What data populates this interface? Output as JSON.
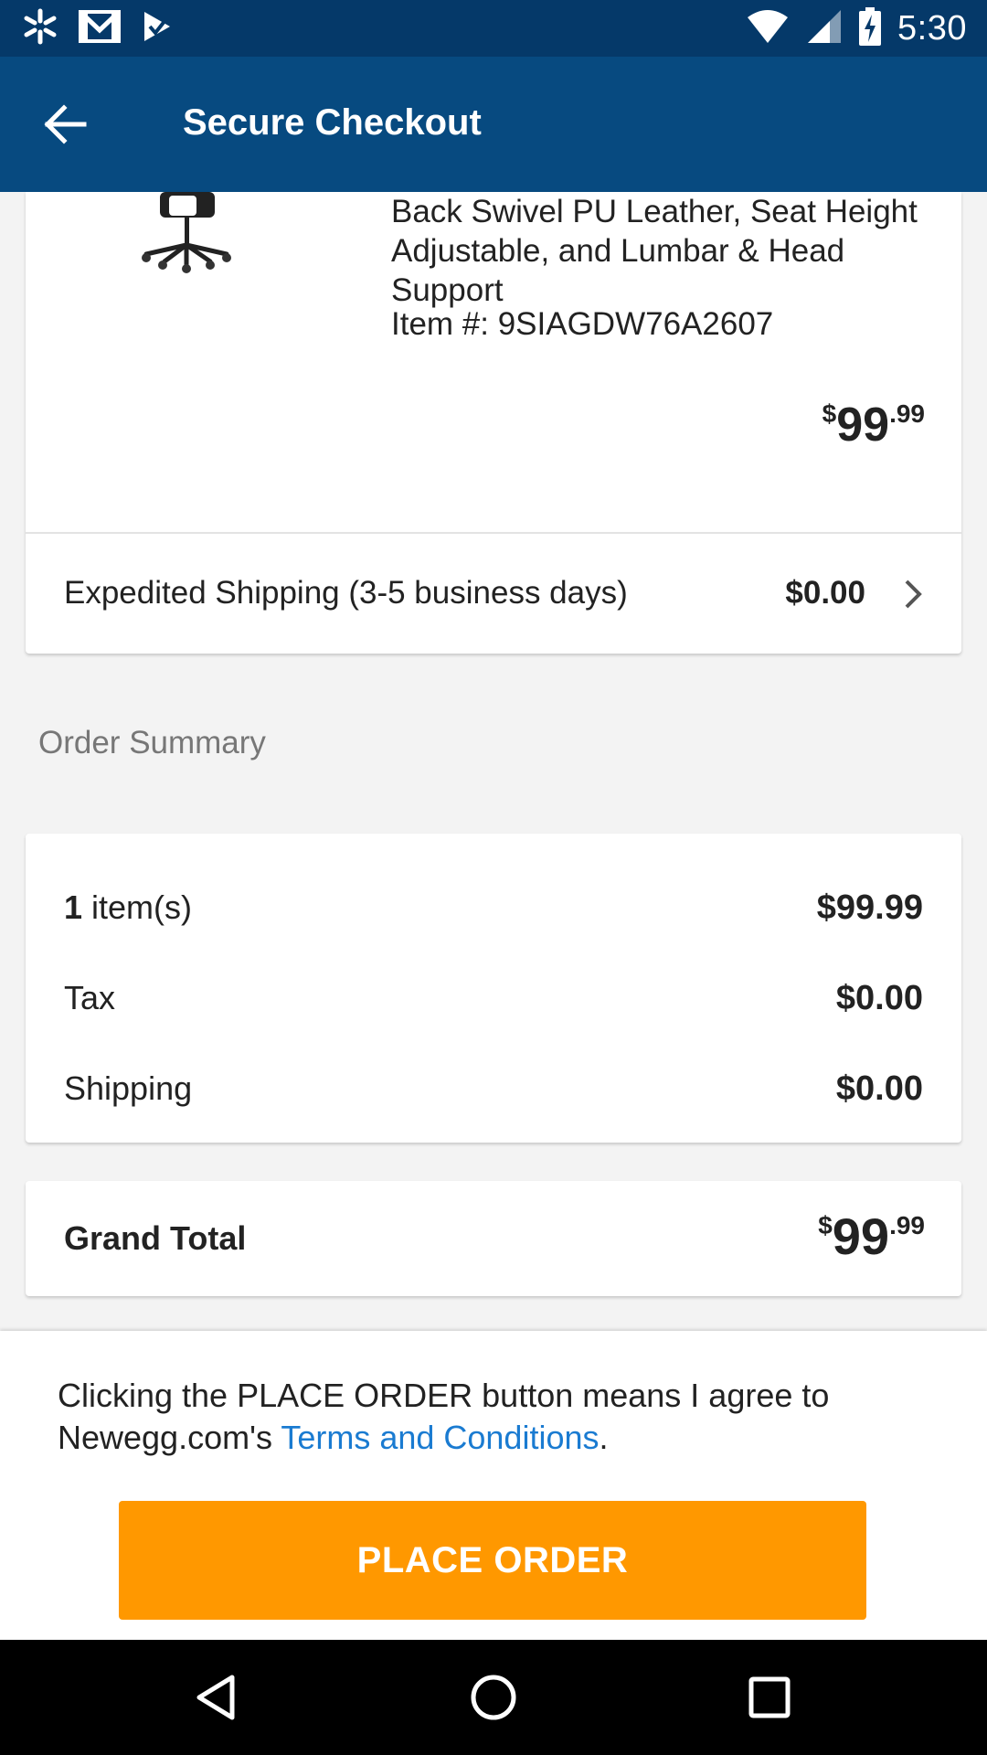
{
  "status_bar": {
    "time": "5:30",
    "icons_left": [
      "walmart-spark-icon",
      "gmail-icon",
      "check-icon"
    ],
    "icons_right": [
      "wifi-icon",
      "signal-icon",
      "battery-charging-icon"
    ]
  },
  "app_bar": {
    "title": "Secure Checkout",
    "back_icon": "arrow-left-icon"
  },
  "product": {
    "name": "Back Swivel PU Leather, Seat Height Adjustable, and Lumbar & Head Support",
    "item_number": "Item #: 9SIAGDW76A2607",
    "price_currency": "$",
    "price_dollars": "99",
    "price_cents": ".99"
  },
  "shipping": {
    "label": "Expedited Shipping (3-5 business days)",
    "price": "$0.00"
  },
  "order_summary": {
    "title": "Order Summary",
    "items_count": "1",
    "items_label": " item(s)",
    "items_value": "$99.99",
    "tax_label": "Tax",
    "tax_value": "$0.00",
    "shipping_label": "Shipping",
    "shipping_value": "$0.00"
  },
  "grand_total": {
    "label": "Grand Total",
    "currency": "$",
    "dollars": "99",
    "cents": ".99"
  },
  "agreement": {
    "text_before": "Clicking the PLACE ORDER button means I agree to Newegg.com's ",
    "link": "Terms and Conditions",
    "text_after": "."
  },
  "place_order_label": "PLACE ORDER",
  "colors": {
    "status_bar": "#053969",
    "app_bar": "#074a80",
    "accent_orange": "#ff9800",
    "link_blue": "#1a7bd1"
  }
}
